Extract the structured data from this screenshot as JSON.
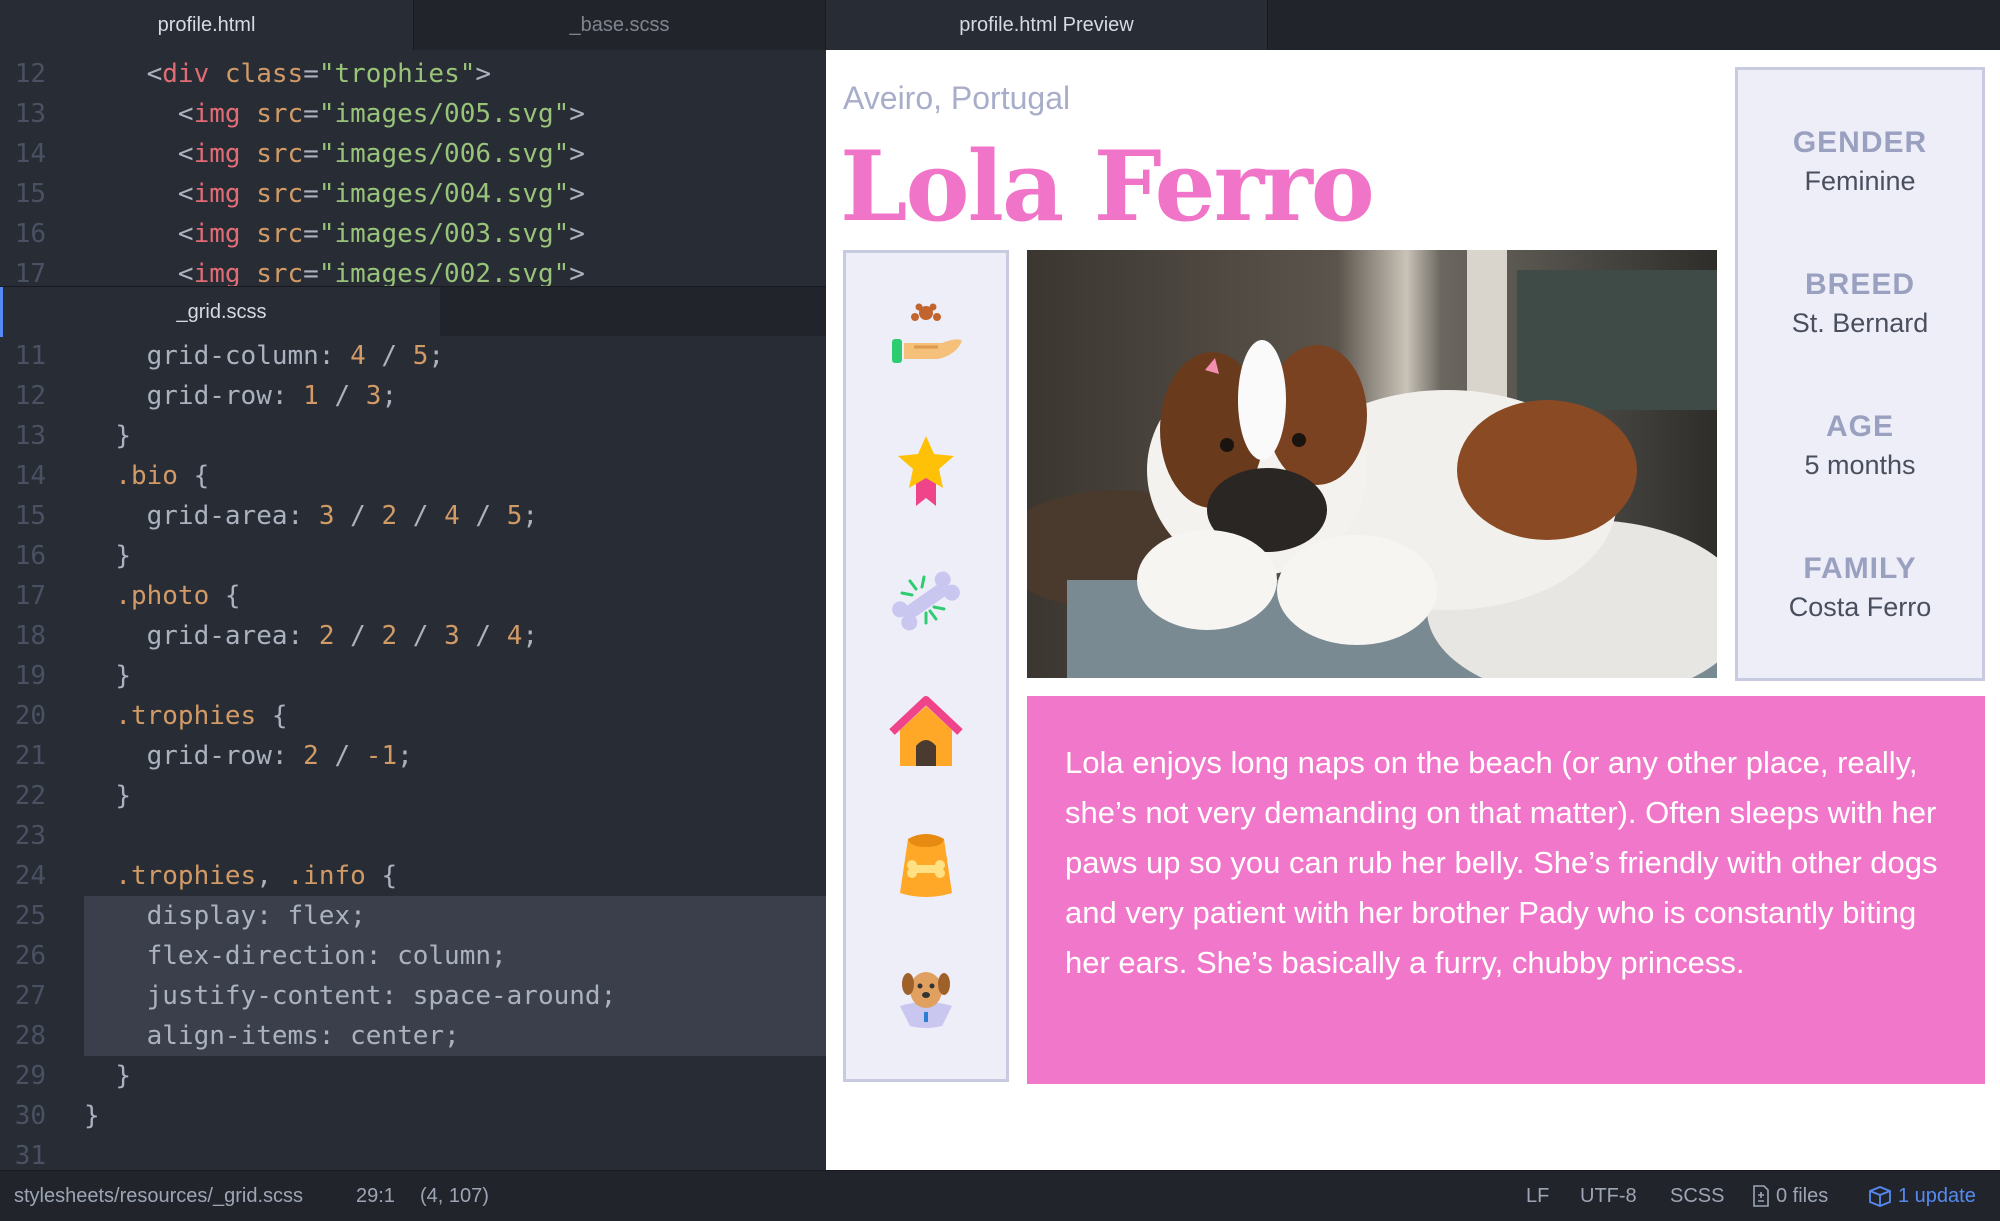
{
  "tabs": {
    "profile": "profile.html",
    "base": "_base.scss",
    "preview": "profile.html Preview"
  },
  "subtab": "_grid.scss",
  "html_lines": [
    {
      "n": "12",
      "indent": "    ",
      "parts": [
        [
          "t-punc",
          "<"
        ],
        [
          "t-tag",
          "div"
        ],
        [
          "t-punc",
          " "
        ],
        [
          "t-attr",
          "class"
        ],
        [
          "t-punc",
          "="
        ],
        [
          "t-str",
          "\"trophies\""
        ],
        [
          "t-punc",
          ">"
        ]
      ]
    },
    {
      "n": "13",
      "indent": "      ",
      "parts": [
        [
          "t-punc",
          "<"
        ],
        [
          "t-tag",
          "img"
        ],
        [
          "t-punc",
          " "
        ],
        [
          "t-attr",
          "src"
        ],
        [
          "t-punc",
          "="
        ],
        [
          "t-str",
          "\"images/005.svg\""
        ],
        [
          "t-punc",
          ">"
        ]
      ]
    },
    {
      "n": "14",
      "indent": "      ",
      "parts": [
        [
          "t-punc",
          "<"
        ],
        [
          "t-tag",
          "img"
        ],
        [
          "t-punc",
          " "
        ],
        [
          "t-attr",
          "src"
        ],
        [
          "t-punc",
          "="
        ],
        [
          "t-str",
          "\"images/006.svg\""
        ],
        [
          "t-punc",
          ">"
        ]
      ]
    },
    {
      "n": "15",
      "indent": "      ",
      "parts": [
        [
          "t-punc",
          "<"
        ],
        [
          "t-tag",
          "img"
        ],
        [
          "t-punc",
          " "
        ],
        [
          "t-attr",
          "src"
        ],
        [
          "t-punc",
          "="
        ],
        [
          "t-str",
          "\"images/004.svg\""
        ],
        [
          "t-punc",
          ">"
        ]
      ]
    },
    {
      "n": "16",
      "indent": "      ",
      "parts": [
        [
          "t-punc",
          "<"
        ],
        [
          "t-tag",
          "img"
        ],
        [
          "t-punc",
          " "
        ],
        [
          "t-attr",
          "src"
        ],
        [
          "t-punc",
          "="
        ],
        [
          "t-str",
          "\"images/003.svg\""
        ],
        [
          "t-punc",
          ">"
        ]
      ]
    },
    {
      "n": "17",
      "indent": "      ",
      "parts": [
        [
          "t-punc",
          "<"
        ],
        [
          "t-tag",
          "img"
        ],
        [
          "t-punc",
          " "
        ],
        [
          "t-attr",
          "src"
        ],
        [
          "t-punc",
          "="
        ],
        [
          "t-str",
          "\"images/002.svg\""
        ],
        [
          "t-punc",
          ">"
        ]
      ]
    }
  ],
  "scss_lines": [
    {
      "n": "11",
      "indent": "    ",
      "parts": [
        [
          "t-prop",
          "grid-column: "
        ],
        [
          "t-num",
          "4"
        ],
        [
          "t-punc",
          " / "
        ],
        [
          "t-num",
          "5"
        ],
        [
          "t-punc",
          ";"
        ]
      ]
    },
    {
      "n": "12",
      "indent": "    ",
      "parts": [
        [
          "t-prop",
          "grid-row: "
        ],
        [
          "t-num",
          "1"
        ],
        [
          "t-punc",
          " / "
        ],
        [
          "t-num",
          "3"
        ],
        [
          "t-punc",
          ";"
        ]
      ]
    },
    {
      "n": "13",
      "indent": "  ",
      "parts": [
        [
          "t-punc",
          "}"
        ]
      ]
    },
    {
      "n": "14",
      "indent": "  ",
      "parts": [
        [
          "t-sel",
          ".bio"
        ],
        [
          "t-punc",
          " {"
        ]
      ]
    },
    {
      "n": "15",
      "indent": "    ",
      "parts": [
        [
          "t-prop",
          "grid-area: "
        ],
        [
          "t-num",
          "3"
        ],
        [
          "t-punc",
          " / "
        ],
        [
          "t-num",
          "2"
        ],
        [
          "t-punc",
          " / "
        ],
        [
          "t-num",
          "4"
        ],
        [
          "t-punc",
          " / "
        ],
        [
          "t-num",
          "5"
        ],
        [
          "t-punc",
          ";"
        ]
      ]
    },
    {
      "n": "16",
      "indent": "  ",
      "parts": [
        [
          "t-punc",
          "}"
        ]
      ]
    },
    {
      "n": "17",
      "indent": "  ",
      "parts": [
        [
          "t-sel",
          ".photo"
        ],
        [
          "t-punc",
          " {"
        ]
      ]
    },
    {
      "n": "18",
      "indent": "    ",
      "parts": [
        [
          "t-prop",
          "grid-area: "
        ],
        [
          "t-num",
          "2"
        ],
        [
          "t-punc",
          " / "
        ],
        [
          "t-num",
          "2"
        ],
        [
          "t-punc",
          " / "
        ],
        [
          "t-num",
          "3"
        ],
        [
          "t-punc",
          " / "
        ],
        [
          "t-num",
          "4"
        ],
        [
          "t-punc",
          ";"
        ]
      ]
    },
    {
      "n": "19",
      "indent": "  ",
      "parts": [
        [
          "t-punc",
          "}"
        ]
      ]
    },
    {
      "n": "20",
      "indent": "  ",
      "parts": [
        [
          "t-sel",
          ".trophies"
        ],
        [
          "t-punc",
          " {"
        ]
      ]
    },
    {
      "n": "21",
      "indent": "    ",
      "parts": [
        [
          "t-prop",
          "grid-row: "
        ],
        [
          "t-num",
          "2"
        ],
        [
          "t-punc",
          " / "
        ],
        [
          "t-num",
          "-1"
        ],
        [
          "t-punc",
          ";"
        ]
      ]
    },
    {
      "n": "22",
      "indent": "  ",
      "parts": [
        [
          "t-punc",
          "}"
        ]
      ]
    },
    {
      "n": "23",
      "indent": "",
      "parts": []
    },
    {
      "n": "24",
      "indent": "  ",
      "parts": [
        [
          "t-sel",
          ".trophies"
        ],
        [
          "t-punc",
          ", "
        ],
        [
          "t-sel",
          ".info"
        ],
        [
          "t-punc",
          " {"
        ]
      ]
    },
    {
      "n": "25",
      "indent": "  ",
      "hl": true,
      "parts": [
        [
          "t-prop",
          "display: flex;"
        ]
      ]
    },
    {
      "n": "26",
      "indent": "  ",
      "hl": true,
      "parts": [
        [
          "t-prop",
          "flex-direction: column;"
        ]
      ]
    },
    {
      "n": "27",
      "indent": "  ",
      "hl": true,
      "parts": [
        [
          "t-prop",
          "justify-content: space-around;"
        ]
      ]
    },
    {
      "n": "28",
      "indent": "  ",
      "hl": true,
      "parts": [
        [
          "t-prop",
          "align-items: center;"
        ]
      ]
    },
    {
      "n": "29",
      "indent": "  ",
      "parts": [
        [
          "t-punc",
          "}"
        ]
      ]
    },
    {
      "n": "30",
      "indent": "",
      "parts": [
        [
          "t-punc",
          "}"
        ]
      ]
    },
    {
      "n": "31",
      "indent": "",
      "parts": []
    }
  ],
  "preview": {
    "location": "Aveiro, Portugal",
    "name": "Lola Ferro",
    "info": [
      {
        "label": "GENDER",
        "value": "Feminine"
      },
      {
        "label": "BREED",
        "value": "St. Bernard"
      },
      {
        "label": "AGE",
        "value": "5 months"
      },
      {
        "label": "FAMILY",
        "value": "Costa Ferro"
      }
    ],
    "bio": "Lola enjoys long naps on the beach (or any other place, really, she’s not very demanding on that matter). Often sleeps with her paws up so you can rub her belly. She’s friendly with other dogs and very patient with her brother Pady who is constantly biting her ears. She’s basically a furry, chubby princess.",
    "trophies": [
      "paw-hand-icon",
      "star-medal-icon",
      "bone-icon",
      "dog-house-icon",
      "food-bag-icon",
      "dog-cone-icon"
    ],
    "photo_alt": "dog-photo"
  },
  "status": {
    "path": "stylesheets/resources/_grid.scss",
    "cursor": "29:1",
    "selection": "(4, 107)",
    "line_ending": "LF",
    "encoding": "UTF-8",
    "grammar": "SCSS",
    "files": "0 files",
    "update": "1 update"
  },
  "colors": {
    "accent_pink": "#f075c8",
    "editor_bg": "#282c34",
    "update_blue": "#568af2"
  }
}
